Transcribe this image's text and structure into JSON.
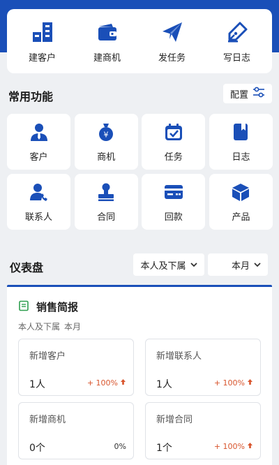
{
  "colors": {
    "primary": "#1a4fb8",
    "up": "#d8542c",
    "green": "#2e9e4f"
  },
  "quick_actions": [
    {
      "label": "建客户",
      "icon": "building-grid-icon"
    },
    {
      "label": "建商机",
      "icon": "wallet-icon"
    },
    {
      "label": "发任务",
      "icon": "paper-plane-icon"
    },
    {
      "label": "写日志",
      "icon": "pen-nib-icon"
    }
  ],
  "common": {
    "title": "常用功能",
    "config_label": "配置",
    "items": [
      {
        "label": "客户",
        "icon": "person-tie-icon"
      },
      {
        "label": "商机",
        "icon": "yen-bag-icon"
      },
      {
        "label": "任务",
        "icon": "calendar-check-icon"
      },
      {
        "label": "日志",
        "icon": "notebook-icon"
      },
      {
        "label": "联系人",
        "icon": "person-phone-icon"
      },
      {
        "label": "合同",
        "icon": "stamp-icon"
      },
      {
        "label": "回款",
        "icon": "card-icon"
      },
      {
        "label": "产品",
        "icon": "cube-icon"
      }
    ]
  },
  "dashboard": {
    "title": "仪表盘",
    "scope_filter": "本人及下属",
    "period_filter": "本月",
    "sales": {
      "title": "销售简报",
      "scope": "本人及下属",
      "period": "本月",
      "stats": [
        {
          "name": "新增客户",
          "value": "1人",
          "change": "+ 100%",
          "trend": "up"
        },
        {
          "name": "新增联系人",
          "value": "1人",
          "change": "+ 100%",
          "trend": "up"
        },
        {
          "name": "新增商机",
          "value": "0个",
          "change": "0%",
          "trend": "none"
        },
        {
          "name": "新增合同",
          "value": "1个",
          "change": "+ 100%",
          "trend": "up"
        }
      ]
    }
  }
}
